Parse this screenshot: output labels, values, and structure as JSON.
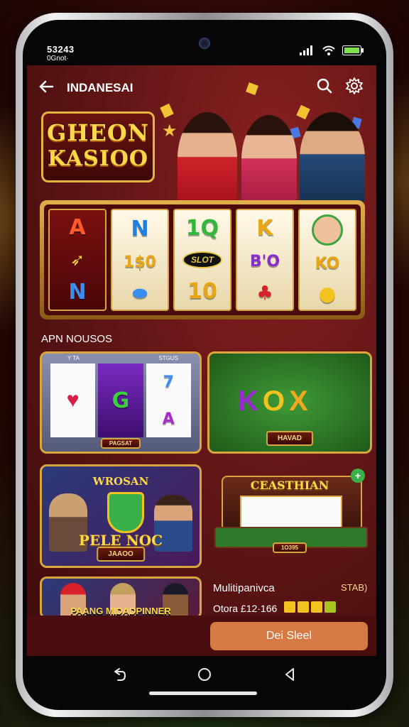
{
  "status": {
    "time": "53243",
    "subtext": "0Gnot·"
  },
  "header": {
    "title": "INDANESAI",
    "back_icon": "arrow-left-icon",
    "search_icon": "search-icon",
    "settings_icon": "gear-icon"
  },
  "hero": {
    "logo_line1": "GHEON",
    "logo_line2": "KASIOO"
  },
  "reels": [
    [
      "A",
      "",
      "N"
    ],
    [
      "N",
      "1$0",
      ""
    ],
    [
      "1Q",
      "SLOT",
      "10"
    ],
    [
      "K",
      "B'O",
      ""
    ],
    [
      "",
      "KO",
      ""
    ]
  ],
  "section": {
    "title": "APN NOUSOS"
  },
  "cards": {
    "slot": {
      "header_left": "Y TA",
      "header_right": "STGUS",
      "footer": "PAGSAT",
      "symbols": [
        "G",
        "7",
        "A"
      ]
    },
    "kox": {
      "text": "KOX",
      "label": "HAVAD"
    },
    "poker": {
      "title": "WROSAN",
      "subtitle": "PELE NOC",
      "label": "JAAOO"
    },
    "table": {
      "title": "CEASTHIAN",
      "label": "1O395"
    },
    "promo": {
      "text": "PAANG MIDADPINNER"
    }
  },
  "multiplayer": {
    "title": "Mulitipanivca",
    "badge": "STAB)",
    "odds": "Otora £12·166"
  },
  "cta": {
    "label": "Dei Sleel"
  },
  "colors": {
    "accent": "#d67a45",
    "gold": "#d8a63c",
    "background": "#5c1414",
    "felt": "#2f7a2a"
  }
}
